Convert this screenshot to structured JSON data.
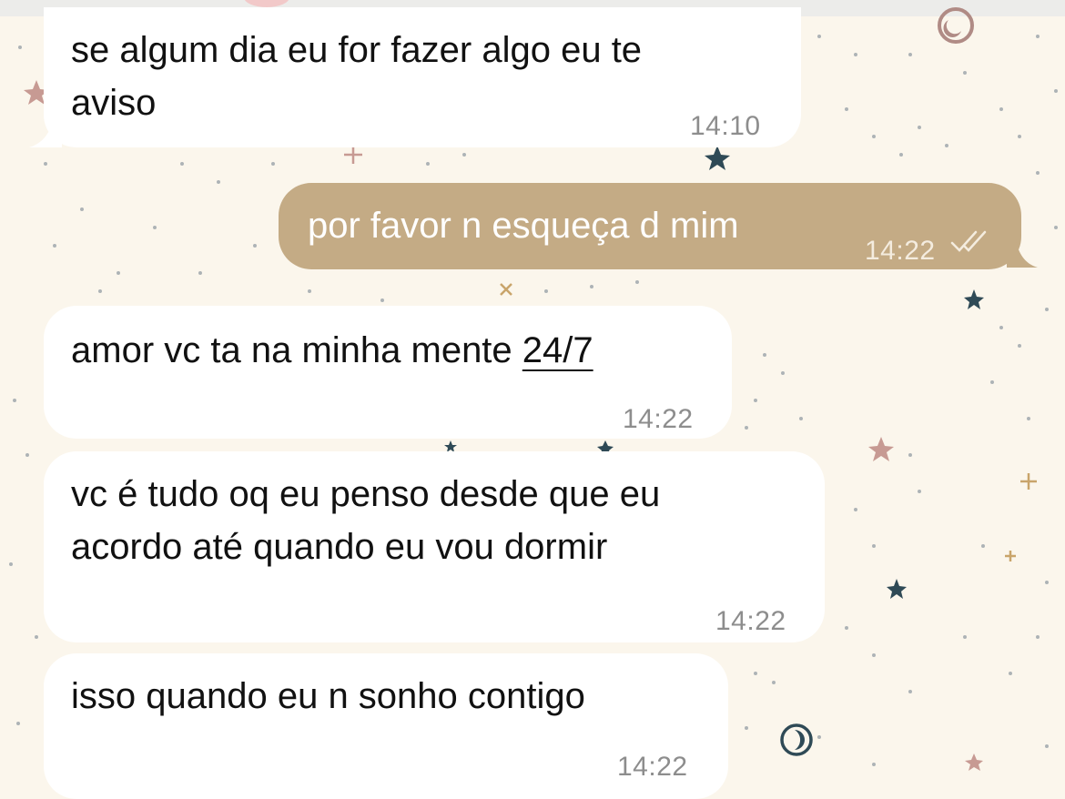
{
  "messages": [
    {
      "direction": "incoming",
      "text": "se algum dia eu for fazer algo eu te\naviso",
      "time": "14:10"
    },
    {
      "direction": "outgoing",
      "text": "por favor n esqueça d mim",
      "time": "14:22",
      "status": "read-double-check-icon"
    },
    {
      "direction": "incoming",
      "text_prefix": "amor vc ta na minha mente ",
      "text_link": "24/7",
      "time": "14:22"
    },
    {
      "direction": "incoming",
      "text": "vc é tudo oq eu penso desde que eu\nacordo até quando eu vou dormir",
      "time": "14:22"
    },
    {
      "direction": "incoming",
      "text": "isso quando eu n sonho contigo",
      "time": "14:22"
    }
  ],
  "theme": {
    "background": "#fbf6ec",
    "incoming_bubble": "#ffffff",
    "outgoing_bubble": "#c4ab85",
    "wallpaper_icons": [
      "star-icon",
      "moon-icon",
      "sparkle-icon",
      "dot-pattern"
    ]
  }
}
